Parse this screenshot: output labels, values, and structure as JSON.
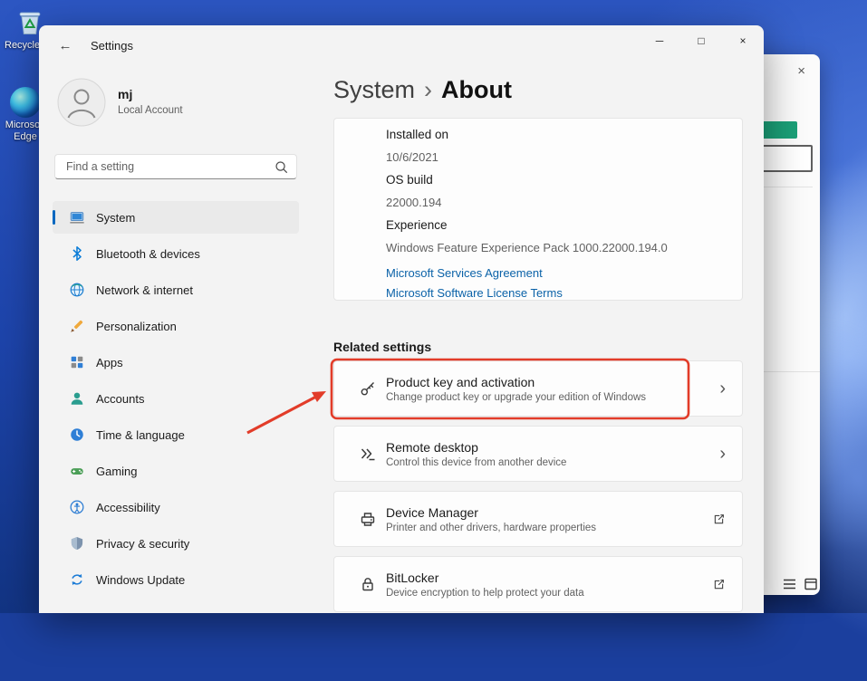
{
  "desktop": {
    "icons": [
      {
        "label": "Recycle Bin",
        "icon": "recycle-bin-icon"
      },
      {
        "label": "Microsoft Edge",
        "icon": "edge-icon"
      }
    ]
  },
  "background_window": {
    "close_glyph": "×"
  },
  "settings_window": {
    "title": "Settings",
    "back_glyph": "←",
    "controls": {
      "minimize": "─",
      "maximize": "□",
      "close": "×"
    }
  },
  "sidebar": {
    "user": {
      "name": "mj",
      "subtitle": "Local Account"
    },
    "search_placeholder": "Find a setting",
    "items": [
      {
        "label": "System",
        "icon": "system-icon",
        "selected": true
      },
      {
        "label": "Bluetooth & devices",
        "icon": "bluetooth-icon",
        "selected": false
      },
      {
        "label": "Network & internet",
        "icon": "network-icon",
        "selected": false
      },
      {
        "label": "Personalization",
        "icon": "personalization-icon",
        "selected": false
      },
      {
        "label": "Apps",
        "icon": "apps-icon",
        "selected": false
      },
      {
        "label": "Accounts",
        "icon": "accounts-icon",
        "selected": false
      },
      {
        "label": "Time & language",
        "icon": "time-language-icon",
        "selected": false
      },
      {
        "label": "Gaming",
        "icon": "gaming-icon",
        "selected": false
      },
      {
        "label": "Accessibility",
        "icon": "accessibility-icon",
        "selected": false
      },
      {
        "label": "Privacy & security",
        "icon": "privacy-icon",
        "selected": false
      },
      {
        "label": "Windows Update",
        "icon": "windows-update-icon",
        "selected": false
      }
    ]
  },
  "main": {
    "breadcrumb": {
      "root": "System",
      "separator": "›",
      "current": "About"
    },
    "chevron_glyph": "›",
    "about_card": {
      "rows": [
        {
          "label": "Installed on",
          "value": "10/6/2021"
        },
        {
          "label": "OS build",
          "value": "22000.194"
        },
        {
          "label": "Experience",
          "value": "Windows Feature Experience Pack 1000.22000.194.0"
        }
      ],
      "links": [
        "Microsoft Services Agreement",
        "Microsoft Software License Terms"
      ]
    },
    "related": {
      "heading": "Related settings",
      "items": [
        {
          "title": "Product key and activation",
          "subtitle": "Change product key or upgrade your edition of Windows",
          "icon": "key-icon",
          "trailing": "chevron",
          "highlighted": true
        },
        {
          "title": "Remote desktop",
          "subtitle": "Control this device from another device",
          "icon": "remote-desktop-icon",
          "trailing": "chevron",
          "highlighted": false
        },
        {
          "title": "Device Manager",
          "subtitle": "Printer and other drivers, hardware properties",
          "icon": "device-manager-icon",
          "trailing": "external-link",
          "highlighted": false
        },
        {
          "title": "BitLocker",
          "subtitle": "Device encryption to help protect your data",
          "icon": "bitlocker-icon",
          "trailing": "external-link",
          "highlighted": false
        }
      ]
    }
  },
  "colors": {
    "accent": "#0067c0",
    "link": "#0b62a8",
    "annotation": "#e23c29",
    "selected_bg": "#eaeaea",
    "green_box": "#1ba078"
  }
}
